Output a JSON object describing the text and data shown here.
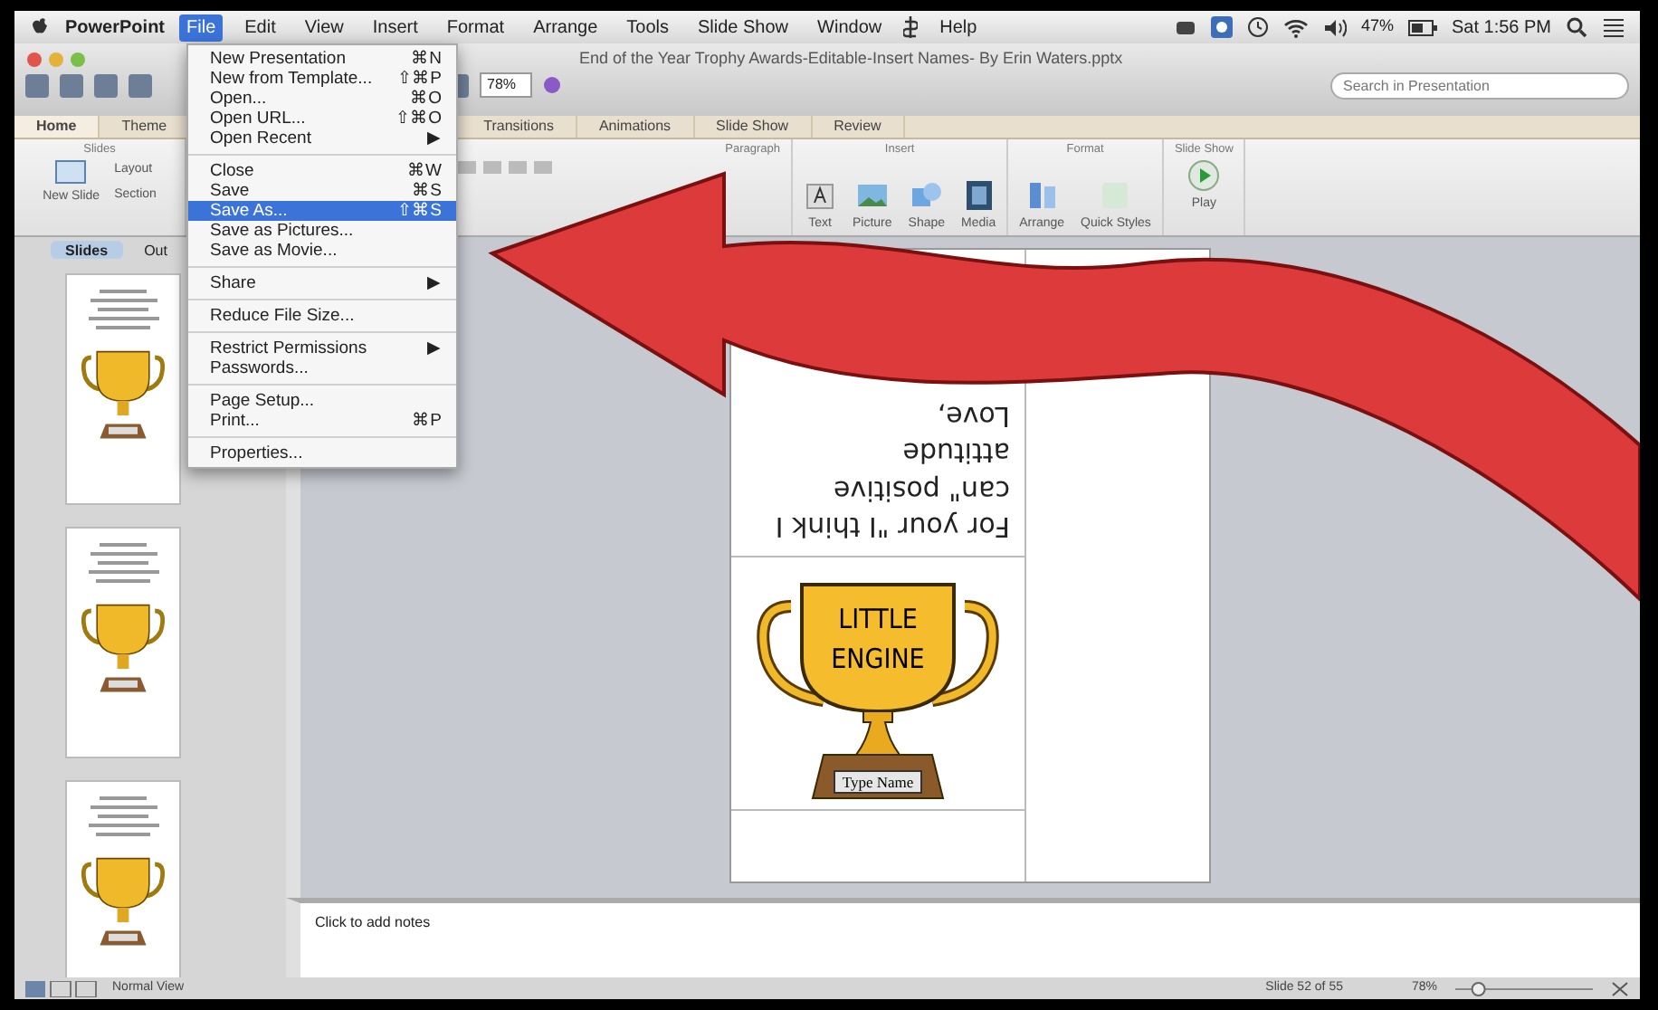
{
  "menubar": {
    "app": "PowerPoint",
    "menus": [
      {
        "label": "File",
        "selected": true
      },
      {
        "label": "Edit",
        "selected": false
      },
      {
        "label": "View",
        "selected": false
      },
      {
        "label": "Insert",
        "selected": false
      },
      {
        "label": "Format",
        "selected": false
      },
      {
        "label": "Arrange",
        "selected": false
      },
      {
        "label": "Tools",
        "selected": false
      },
      {
        "label": "Slide Show",
        "selected": false
      },
      {
        "label": "Window",
        "selected": false
      },
      {
        "label": "Help",
        "selected": false
      }
    ],
    "battery": "47%",
    "clock": "Sat 1:56 PM"
  },
  "window": {
    "title": "End of the Year Trophy Awards-Editable-Insert Names- By Erin Waters.pptx",
    "zoom": "78%",
    "search": {
      "placeholder": "Search in Presentation"
    }
  },
  "ribbon_tabs": [
    {
      "label": "Home",
      "selected": true
    },
    {
      "label": "Theme",
      "selected": false
    },
    {
      "label": "Transitions",
      "selected": false
    },
    {
      "label": "Animations",
      "selected": false
    },
    {
      "label": "Slide Show",
      "selected": false
    },
    {
      "label": "Review",
      "selected": false
    }
  ],
  "ribbon": {
    "slides_group": {
      "title": "Slides",
      "new_slide": "New Slide",
      "layout": "Layout",
      "section": "Section"
    },
    "paragraph_group": {
      "title": "Paragraph"
    },
    "insert_group": {
      "title": "Insert",
      "buttons": [
        "Text",
        "Picture",
        "Shape",
        "Media"
      ]
    },
    "format_group": {
      "title": "Format",
      "buttons": [
        "Arrange",
        "Quick Styles"
      ]
    },
    "slideshow_group": {
      "title": "Slide Show",
      "play": "Play"
    }
  },
  "file_menu": [
    {
      "kind": "item",
      "label": "New Presentation",
      "shortcut": "⌘N",
      "selected": false
    },
    {
      "kind": "item",
      "label": "New from Template...",
      "shortcut": "⇧⌘P",
      "selected": false
    },
    {
      "kind": "item",
      "label": "Open...",
      "shortcut": "⌘O",
      "selected": false
    },
    {
      "kind": "item",
      "label": "Open URL...",
      "shortcut": "⇧⌘O",
      "selected": false
    },
    {
      "kind": "item",
      "label": "Open Recent",
      "shortcut": "▶",
      "selected": false
    },
    {
      "kind": "separator"
    },
    {
      "kind": "item",
      "label": "Close",
      "shortcut": "⌘W",
      "selected": false
    },
    {
      "kind": "item",
      "label": "Save",
      "shortcut": "⌘S",
      "selected": false
    },
    {
      "kind": "item",
      "label": "Save As...",
      "shortcut": "⇧⌘S",
      "selected": true
    },
    {
      "kind": "item",
      "label": "Save as Pictures...",
      "selected": false
    },
    {
      "kind": "item",
      "label": "Save as Movie...",
      "selected": false
    },
    {
      "kind": "separator"
    },
    {
      "kind": "item",
      "label": "Share",
      "shortcut": "▶",
      "selected": false
    },
    {
      "kind": "separator"
    },
    {
      "kind": "item",
      "label": "Reduce File Size...",
      "selected": false
    },
    {
      "kind": "separator"
    },
    {
      "kind": "item",
      "label": "Restrict Permissions",
      "shortcut": "▶",
      "selected": false
    },
    {
      "kind": "item",
      "label": "Passwords...",
      "selected": false
    },
    {
      "kind": "separator"
    },
    {
      "kind": "item",
      "label": "Page Setup...",
      "selected": false
    },
    {
      "kind": "item",
      "label": "Print...",
      "shortcut": "⌘P",
      "selected": false
    },
    {
      "kind": "separator"
    },
    {
      "kind": "item",
      "label": "Properties...",
      "selected": false
    }
  ],
  "side_tabs": [
    {
      "label": "Slides",
      "selected": true
    },
    {
      "label": "Out",
      "selected": false
    }
  ],
  "thumbnails": [
    {
      "selected": false
    },
    {
      "selected": false
    },
    {
      "selected": false
    }
  ],
  "slide": {
    "message": "For your \"I think I can\" positive attitude",
    "closing": "Love,",
    "trophy_text": "LITTLE ENGINE",
    "name_plate": "Type Name"
  },
  "notes": {
    "placeholder": "Click to add notes"
  },
  "status_bar": {
    "view": "Normal View",
    "position": "Slide 52 of 55",
    "zoom": "78%",
    "zoom_slider": {
      "level": 0.15
    }
  }
}
